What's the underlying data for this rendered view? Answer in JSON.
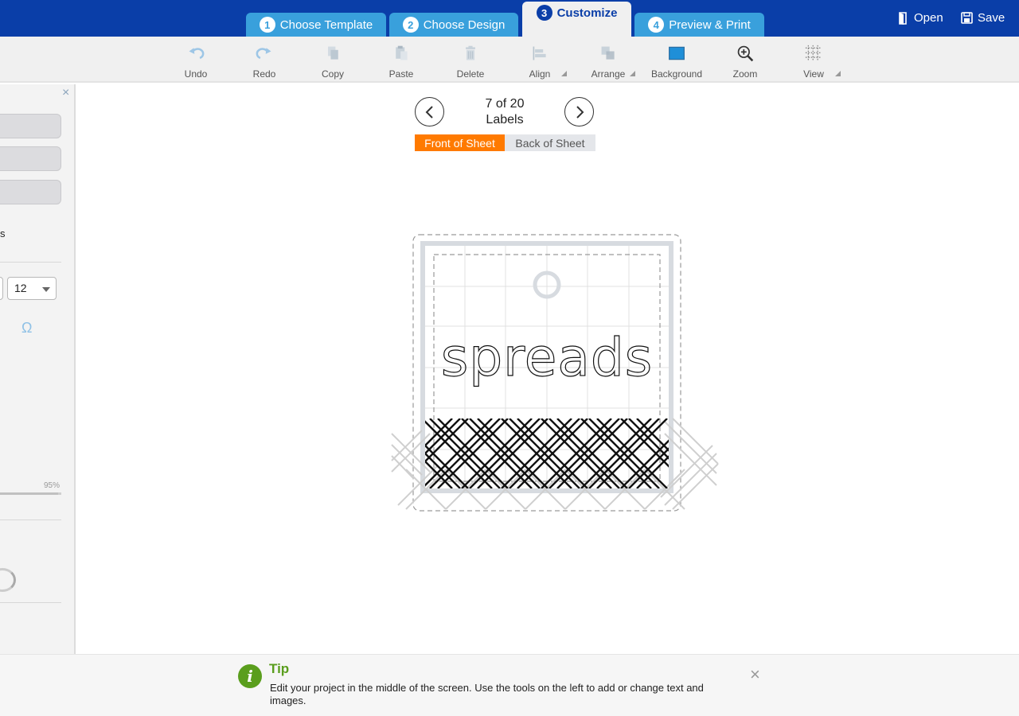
{
  "header": {
    "tabs": [
      {
        "num": "1",
        "label": "Choose Template"
      },
      {
        "num": "2",
        "label": "Choose Design"
      },
      {
        "num": "3",
        "label": "Customize"
      },
      {
        "num": "4",
        "label": "Preview & Print"
      }
    ],
    "open_label": "Open",
    "save_label": "Save"
  },
  "toolbar": {
    "undo": "Undo",
    "redo": "Redo",
    "copy": "Copy",
    "paste": "Paste",
    "delete": "Delete",
    "align": "Align",
    "arrange": "Arrange",
    "background": "Background",
    "zoom": "Zoom",
    "view": "View"
  },
  "left_panel": {
    "close_icon": "×",
    "partial_text": "s",
    "font_size": "12",
    "omega": "Ω",
    "opacity_label": "95%",
    "opacity_value": 0.95
  },
  "label_nav": {
    "counter": "7 of 20",
    "unit": "Labels",
    "front_tab": "Front of Sheet",
    "back_tab": "Back of Sheet"
  },
  "label": {
    "text": "spreads"
  },
  "tip": {
    "icon": "i",
    "title": "Tip",
    "body": "Edit your project in the middle of the screen. Use the tools on the left to add or change text and images.",
    "close": "×"
  },
  "colors": {
    "header_bg": "#0a3ea8",
    "tab_bg": "#39a0dc",
    "front_tab": "#ff7a00",
    "tip_green": "#5a9e1d"
  }
}
